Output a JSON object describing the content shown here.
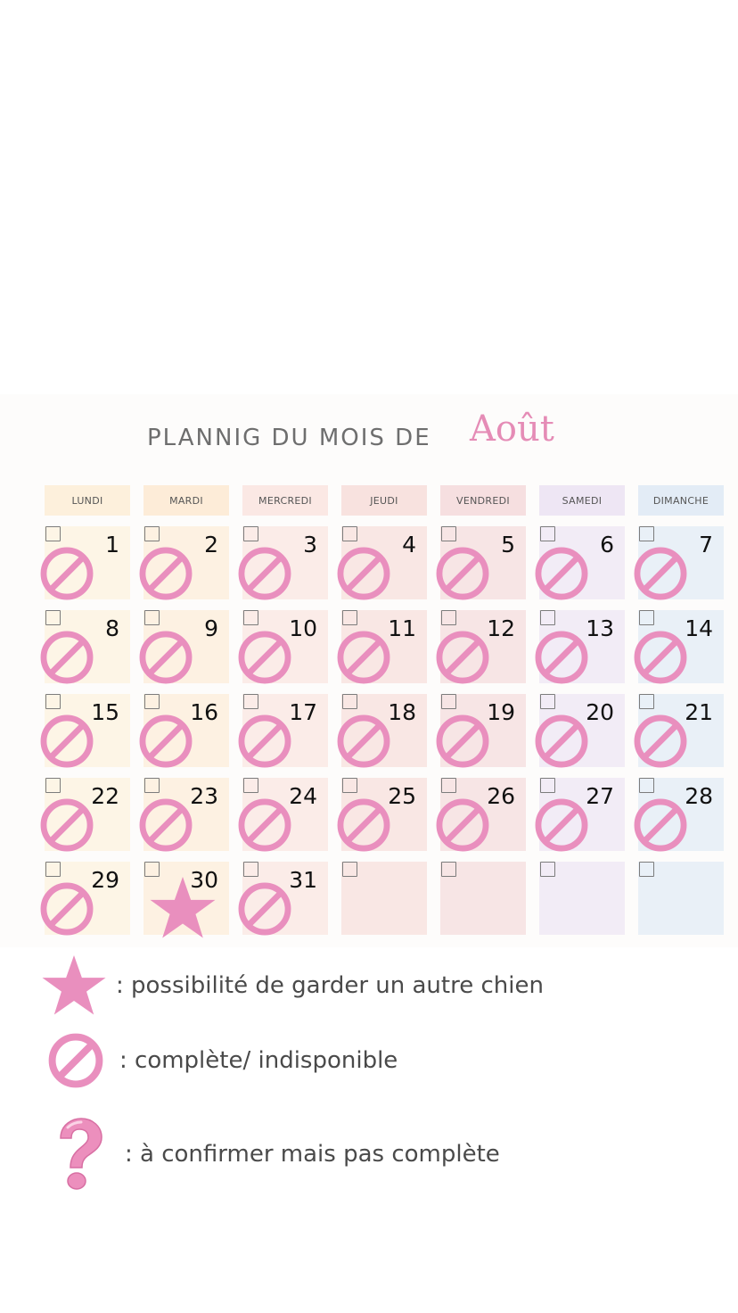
{
  "title": {
    "main": "PLANNIG DU MOIS DE",
    "month": "Août"
  },
  "colors": {
    "pink": "#e98fbe",
    "col_bg": [
      "#fdf5e6",
      "#fdf1e2",
      "#fbece8",
      "#f9e7e4",
      "#f7e5e5",
      "#f2ecf6",
      "#e9f0f7"
    ],
    "header_bg": [
      "#fdf0dc",
      "#fdecd8",
      "#fbe8e4",
      "#f8e2df",
      "#f6dfe0",
      "#eee6f4",
      "#e3ecf6"
    ]
  },
  "weekdays": [
    "LUNDI",
    "MARDI",
    "MERCREDI",
    "JEUDI",
    "VENDREDI",
    "SAMEDI",
    "DIMANCHE"
  ],
  "weeks": [
    [
      {
        "day": "1",
        "mark": "unavailable"
      },
      {
        "day": "2",
        "mark": "unavailable"
      },
      {
        "day": "3",
        "mark": "unavailable"
      },
      {
        "day": "4",
        "mark": "unavailable"
      },
      {
        "day": "5",
        "mark": "unavailable"
      },
      {
        "day": "6",
        "mark": "unavailable"
      },
      {
        "day": "7",
        "mark": "unavailable"
      }
    ],
    [
      {
        "day": "8",
        "mark": "unavailable"
      },
      {
        "day": "9",
        "mark": "unavailable"
      },
      {
        "day": "10",
        "mark": "unavailable"
      },
      {
        "day": "11",
        "mark": "unavailable"
      },
      {
        "day": "12",
        "mark": "unavailable"
      },
      {
        "day": "13",
        "mark": "unavailable"
      },
      {
        "day": "14",
        "mark": "unavailable"
      }
    ],
    [
      {
        "day": "15",
        "mark": "unavailable"
      },
      {
        "day": "16",
        "mark": "unavailable"
      },
      {
        "day": "17",
        "mark": "unavailable"
      },
      {
        "day": "18",
        "mark": "unavailable"
      },
      {
        "day": "19",
        "mark": "unavailable"
      },
      {
        "day": "20",
        "mark": "unavailable"
      },
      {
        "day": "21",
        "mark": "unavailable"
      }
    ],
    [
      {
        "day": "22",
        "mark": "unavailable"
      },
      {
        "day": "23",
        "mark": "unavailable"
      },
      {
        "day": "24",
        "mark": "unavailable"
      },
      {
        "day": "25",
        "mark": "unavailable"
      },
      {
        "day": "26",
        "mark": "unavailable"
      },
      {
        "day": "27",
        "mark": "unavailable"
      },
      {
        "day": "28",
        "mark": "unavailable"
      }
    ],
    [
      {
        "day": "29",
        "mark": "unavailable"
      },
      {
        "day": "30",
        "mark": "star"
      },
      {
        "day": "31",
        "mark": "unavailable"
      },
      {
        "day": "",
        "mark": ""
      },
      {
        "day": "",
        "mark": ""
      },
      {
        "day": "",
        "mark": ""
      },
      {
        "day": "",
        "mark": ""
      }
    ]
  ],
  "legend": [
    {
      "icon": "star-icon",
      "text": ": possibilité de garder un autre chien"
    },
    {
      "icon": "prohibited-icon",
      "text": ": complète/ indisponible"
    },
    {
      "icon": "question-mark-icon",
      "text": ": à confirmer mais pas complète"
    }
  ]
}
